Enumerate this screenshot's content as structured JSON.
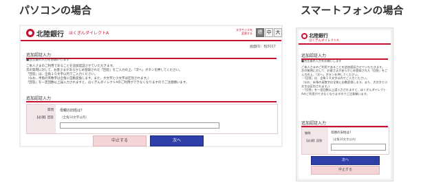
{
  "titles": {
    "pc": "パソコンの場合",
    "smartphone": "スマートフォンの場合"
  },
  "pc": {
    "bank_name": "北陸銀行",
    "service_name": "ほくぎんダイレクトA",
    "font_size_note": "文字サイズを\n変更する",
    "font_buttons": [
      "標",
      "中",
      "大"
    ],
    "screen_id": "画面ID：BJ3017",
    "section1_heading": "追加認証入力",
    "notes": [
      "■合言葉の入力をお願いします",
      "ご本人さまのご利用であることを追加認証させていただきます。",
      "次の質問に対して、お客さまがあらかじめ登録された「回答」をご入力の上、「次へ」ボタンを押してください。",
      "「回答」は、全角１０文字以内でご入力ください。",
      "（なお、半角の英数字は全角に自動変換します。また、大文字と小文字は区別されます。）",
      "「回答」を一定回数以上誤入力されますと、ほくぎんダイレクトAのご利用ができなくなりますのでご注意願います。"
    ],
    "section2_heading": "追加認証入力",
    "question_label": "質問",
    "answer_label": "【必須】回答",
    "question_text": "母親の旧姓は？",
    "answer_hint": "（全角10文字以内）",
    "answer_value": "",
    "cancel_label": "中止する",
    "next_label": "次へ"
  },
  "smartphone": {
    "bank_name": "北陸銀行",
    "service_name": "ほくぎんダイレクトA",
    "section1_heading": "追加認証入力",
    "notes": [
      "■合言葉の入力をお願いします",
      "ご本人さまのご利用であることを追加認証させていただきます。",
      "次の質問に対して、お客さまがあらかじめ登録された「回答」をご入力の上、「次へ」ボタンを押してください。",
      "・「回答」は、全角１０文字以内でご入力ください。",
      "（なお、半角の英数字は全角に自動変換します。また、大文字と小文字は区別されます。）",
      "・「回答」を一定回数以上誤入力されますと、ほくぎんダイレクトAのご利用ができなくなりますのでご注意願います。"
    ],
    "section2_heading": "追加認証入力",
    "question_label": "質問",
    "answer_label": "【必須】回答",
    "question_text": "母親の旧姓は？",
    "answer_hint": "（全角10文字以内）",
    "answer_value": "",
    "next_label": "次へ",
    "cancel_label": "中止する"
  },
  "colors": {
    "brand_red": "#c8102e",
    "next_button": "#2f3fa8",
    "cancel_button": "#f5d4d8"
  }
}
